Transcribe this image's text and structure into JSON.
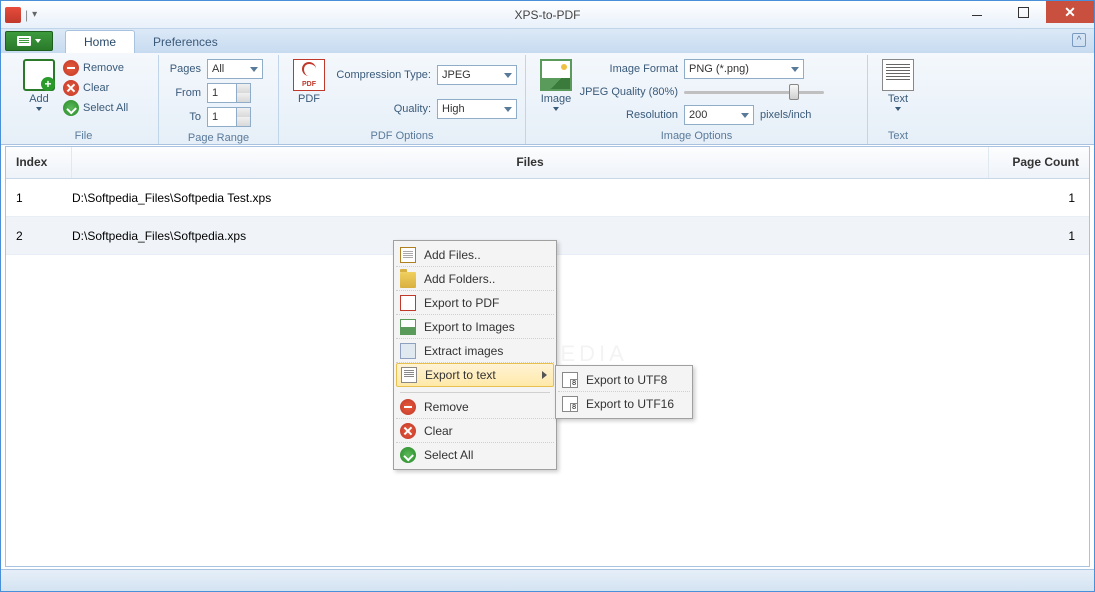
{
  "window": {
    "title": "XPS-to-PDF"
  },
  "tabs": {
    "home": "Home",
    "preferences": "Preferences"
  },
  "ribbon": {
    "file": {
      "group_label": "File",
      "add": "Add",
      "remove": "Remove",
      "clear": "Clear",
      "select_all": "Select All"
    },
    "page_range": {
      "group_label": "Page Range",
      "pages_label": "Pages",
      "pages_value": "All",
      "from_label": "From",
      "from_value": "1",
      "to_label": "To",
      "to_value": "1"
    },
    "pdf_options": {
      "group_label": "PDF Options",
      "pdf": "PDF",
      "compression_label": "Compression Type:",
      "compression_value": "JPEG",
      "quality_label": "Quality:",
      "quality_value": "High"
    },
    "image_options": {
      "group_label": "Image Options",
      "image": "Image",
      "format_label": "Image Format",
      "format_value": "PNG (*.png)",
      "jpeg_quality": "JPEG Quality (80%)",
      "resolution_label": "Resolution",
      "resolution_value": "200",
      "resolution_unit": "pixels/inch"
    },
    "text": {
      "group_label": "Text",
      "text": "Text"
    }
  },
  "table": {
    "headers": {
      "index": "Index",
      "files": "Files",
      "page_count": "Page Count"
    },
    "rows": [
      {
        "index": "1",
        "file": "D:\\Softpedia_Files\\Softpedia Test.xps",
        "count": "1"
      },
      {
        "index": "2",
        "file": "D:\\Softpedia_Files\\Softpedia.xps",
        "count": "1"
      }
    ]
  },
  "context_menu": {
    "add_files": "Add Files..",
    "add_folders": "Add Folders..",
    "export_pdf": "Export to PDF",
    "export_images": "Export to Images",
    "extract_images": "Extract images",
    "export_text": "Export to text",
    "remove": "Remove",
    "clear": "Clear",
    "select_all": "Select All",
    "sub": {
      "utf8": "Export to UTF8",
      "utf16": "Export to UTF16"
    }
  },
  "watermark": "SOFTPEDIA"
}
